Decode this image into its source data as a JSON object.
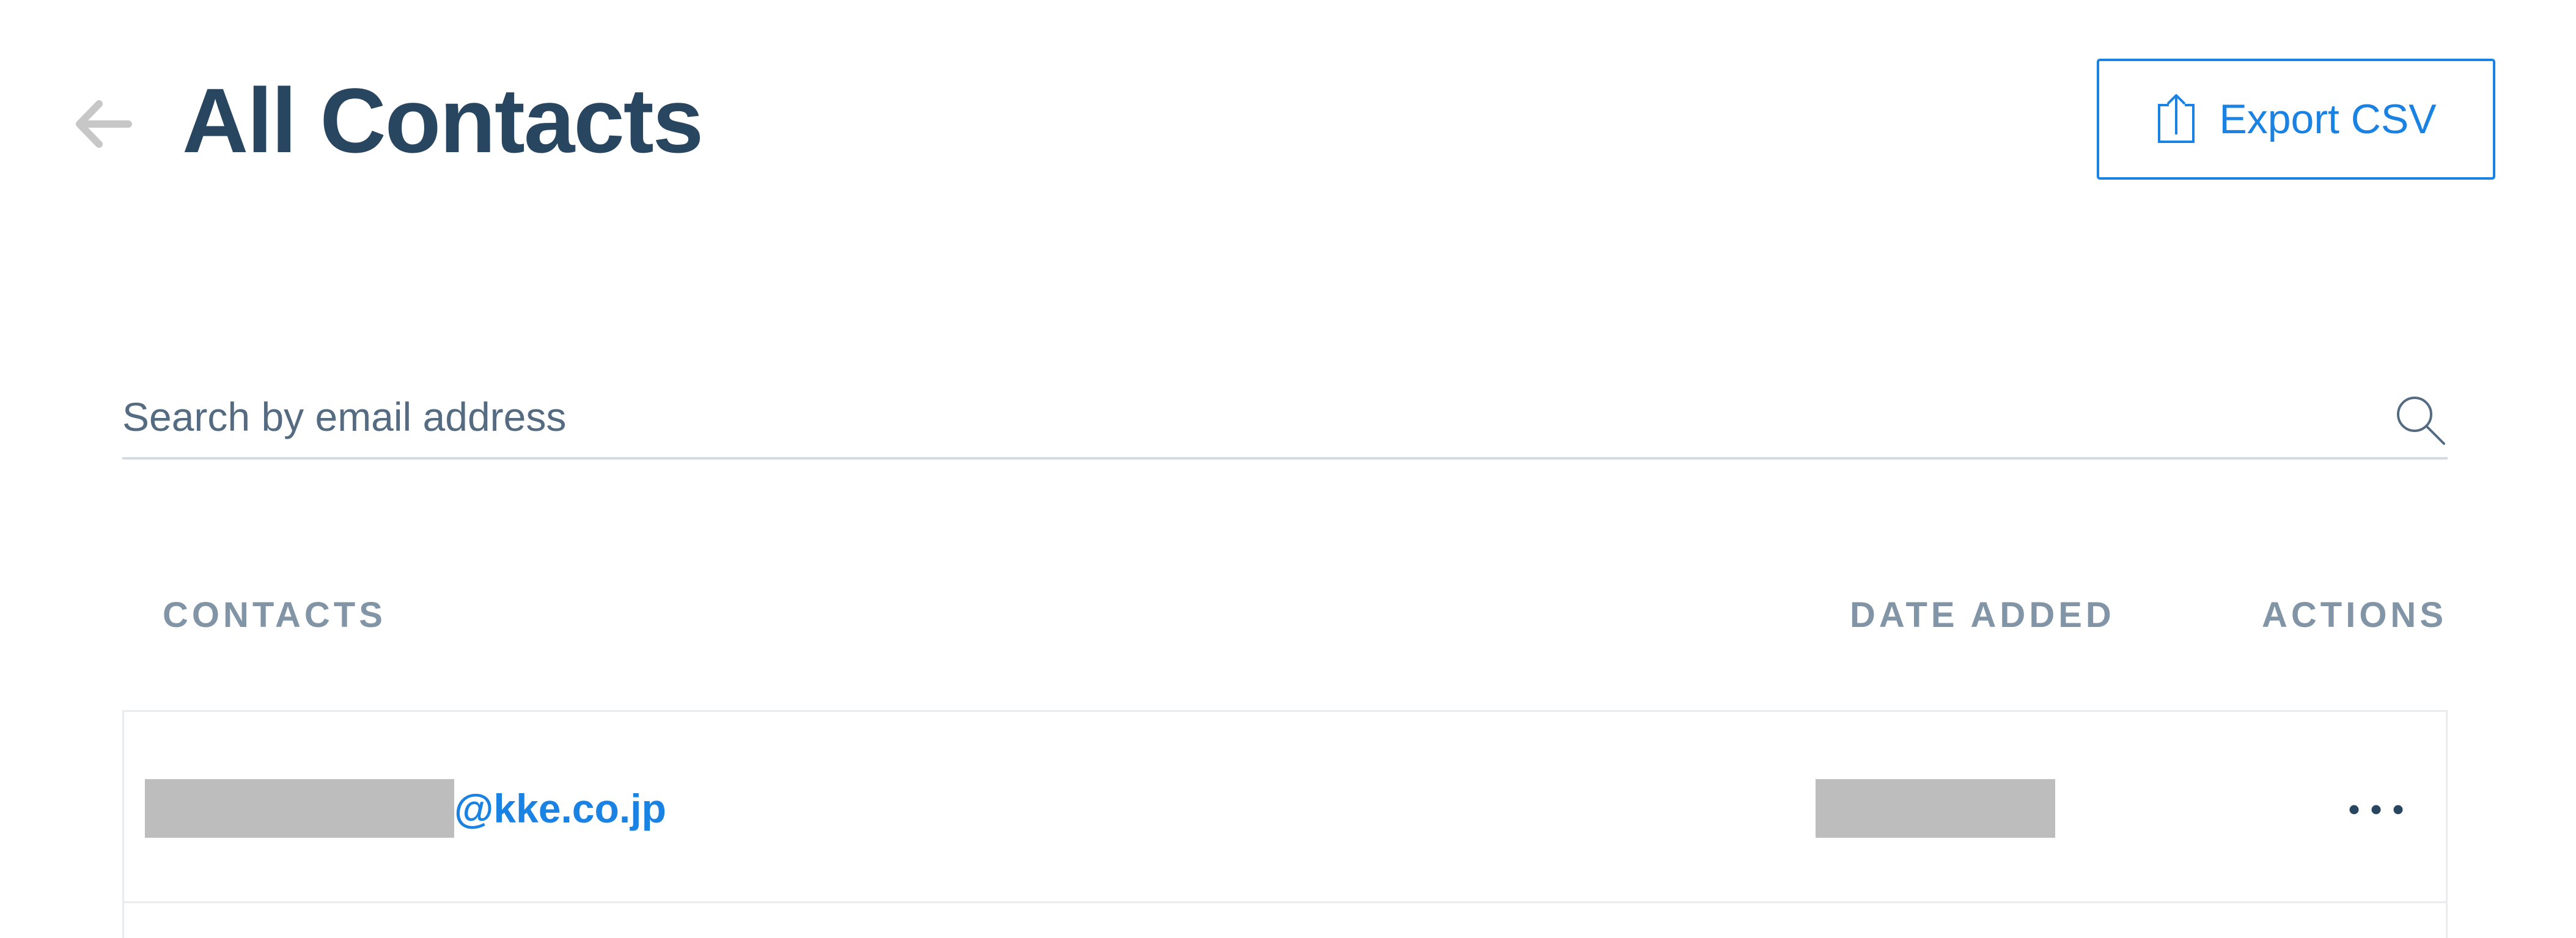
{
  "header": {
    "back_icon": "arrow-left-icon",
    "title": "All Contacts",
    "export_label": "Export CSV",
    "export_icon": "upload-icon"
  },
  "search": {
    "placeholder": "Search by email address",
    "value": "",
    "icon": "search-icon"
  },
  "table": {
    "columns": [
      "CONTACTS",
      "DATE ADDED",
      "ACTIONS"
    ],
    "rows": [
      {
        "email_domain": "@kke.co.jp",
        "email_redacted": true,
        "date_redacted": true,
        "actions_icon": "more-horizontal-icon"
      }
    ]
  },
  "colors": {
    "title": "#294661",
    "accent": "#1a82e2",
    "column_header": "#8295a6",
    "redaction": "#bdbdbd",
    "muted_icon": "#c7c7c7"
  }
}
